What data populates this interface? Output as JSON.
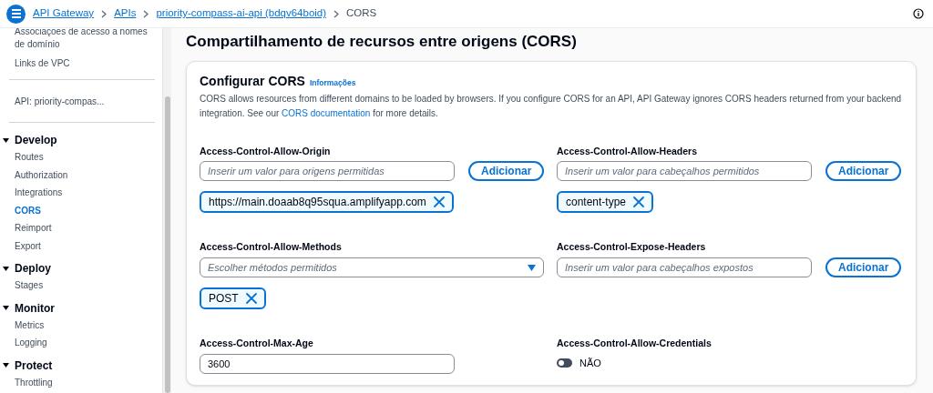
{
  "breadcrumb": [
    {
      "label": "API Gateway",
      "kind": "link"
    },
    {
      "label": "APIs",
      "kind": "link"
    },
    {
      "label": "priority-compass-ai-api (bdqv64boid)",
      "kind": "link"
    },
    {
      "label": "CORS",
      "kind": "current"
    }
  ],
  "sidebar": {
    "top_items": [
      "Associações de acesso a nomes de domínio",
      "Links de VPC"
    ],
    "api_label": "API: priority-compas...",
    "groups": [
      {
        "title": "Develop",
        "expanded": true,
        "items": [
          {
            "label": "Routes",
            "selected": false
          },
          {
            "label": "Authorization",
            "selected": false
          },
          {
            "label": "Integrations",
            "selected": false
          },
          {
            "label": "CORS",
            "selected": true
          },
          {
            "label": "Reimport",
            "selected": false
          },
          {
            "label": "Export",
            "selected": false
          }
        ]
      },
      {
        "title": "Deploy",
        "expanded": true,
        "items": [
          {
            "label": "Stages",
            "selected": false
          }
        ]
      },
      {
        "title": "Monitor",
        "expanded": true,
        "items": [
          {
            "label": "Metrics",
            "selected": false
          },
          {
            "label": "Logging",
            "selected": false
          }
        ]
      },
      {
        "title": "Protect",
        "expanded": true,
        "items": [
          {
            "label": "Throttling",
            "selected": false
          }
        ]
      }
    ]
  },
  "page_title": "Compartilhamento de recursos entre origens (CORS)",
  "card": {
    "title": "Configurar CORS",
    "info_link": "Informações",
    "description": {
      "before": "CORS allows resources from different domains to be loaded by browsers. If you configure CORS for an API, API Gateway ignores CORS headers returned from your backend integration. See our",
      "link": "CORS documentation",
      "after": "for more details."
    },
    "fields": [
      {
        "kind": "tokens",
        "label": "Access-Control-Allow-Origin",
        "placeholder": "Inserir um valor para origens permitidas",
        "button": "Adicionar",
        "tokens": [
          "https://main.doaab8q95squa.amplifyapp.com"
        ]
      },
      {
        "kind": "tokens",
        "label": "Access-Control-Allow-Headers",
        "placeholder": "Inserir um valor para cabeçalhos permitidos",
        "button": "Adicionar",
        "tokens": [
          "content-type"
        ]
      },
      {
        "kind": "select",
        "label": "Access-Control-Allow-Methods",
        "placeholder": "Escolher métodos permitidos",
        "tokens": [
          "POST"
        ]
      },
      {
        "kind": "tokens",
        "label": "Access-Control-Expose-Headers",
        "placeholder": "Inserir um valor para cabeçalhos expostos",
        "button": "Adicionar"
      },
      {
        "kind": "text",
        "label": "Access-Control-Max-Age",
        "value": "3600"
      },
      {
        "kind": "toggle",
        "label": "Access-Control-Allow-Credentials",
        "on": false,
        "state_label": "NÃO"
      }
    ]
  }
}
